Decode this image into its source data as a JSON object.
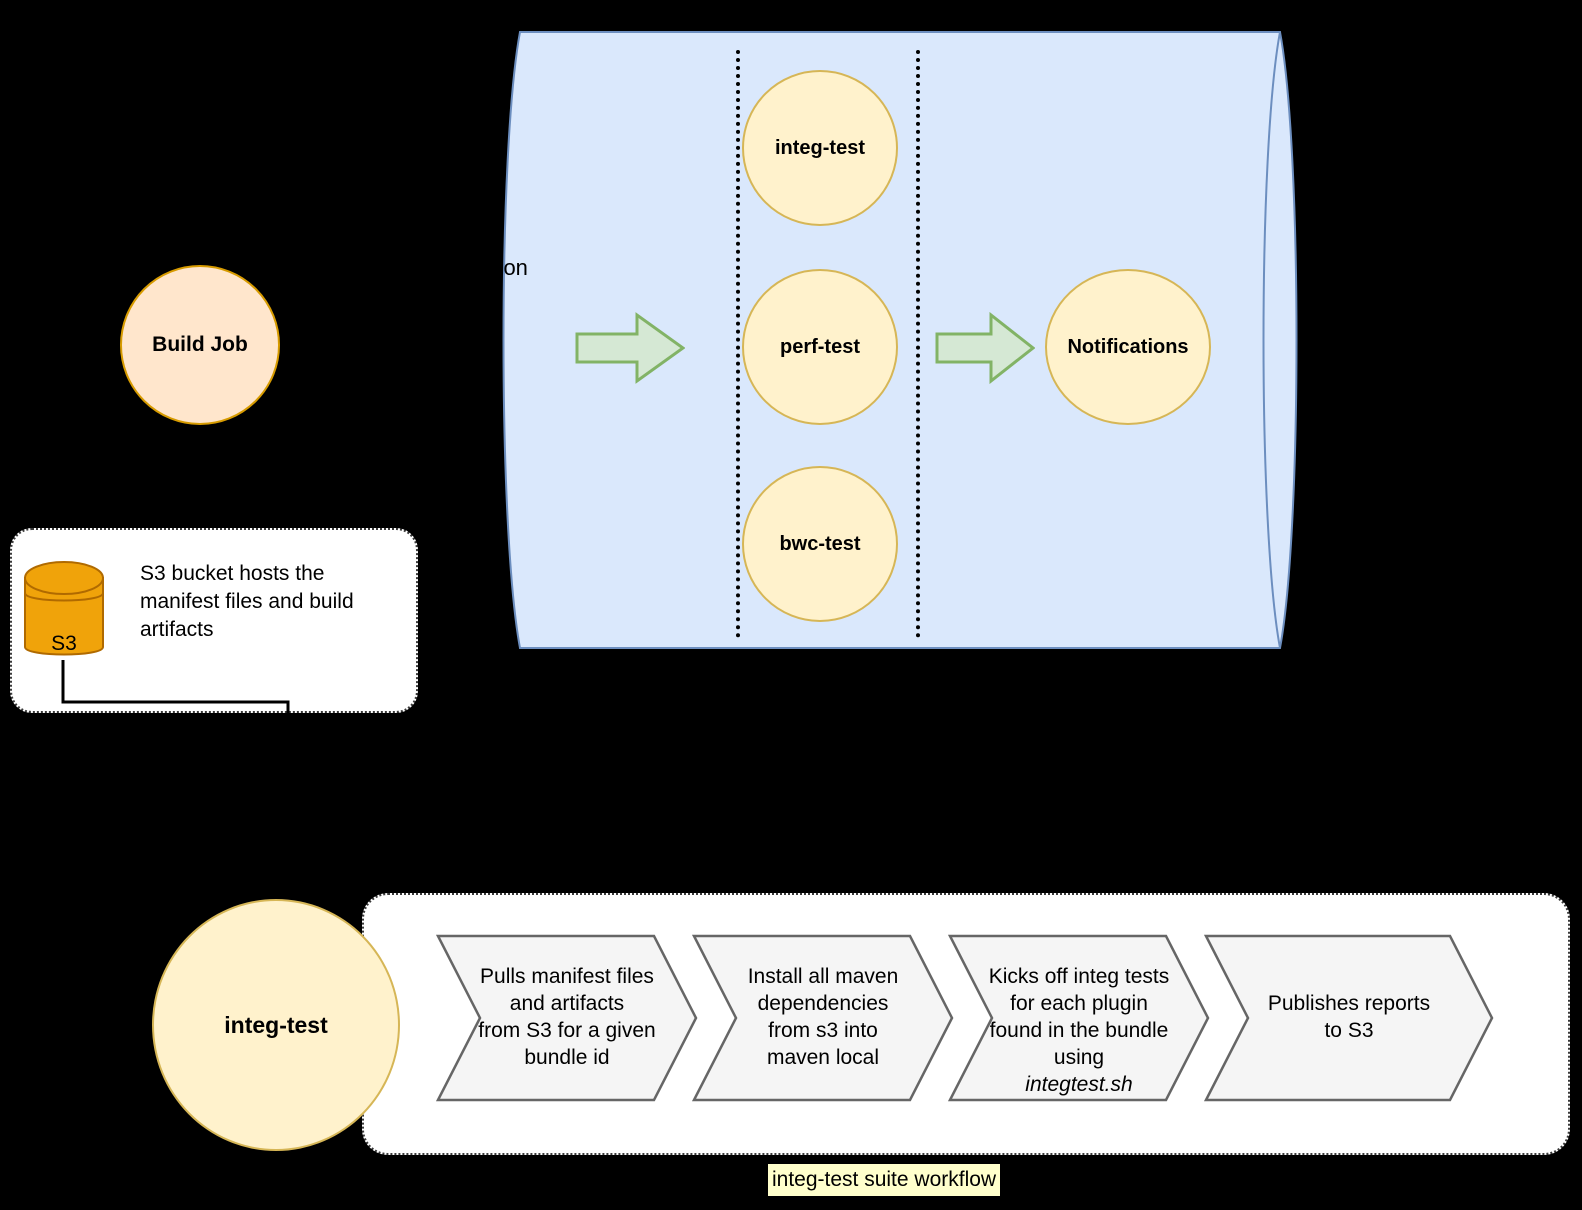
{
  "diagram": {
    "title": "integ-test suite workflow",
    "caption_highlight_color": "#FFFFCC"
  },
  "build": {
    "job_label": "Build Job"
  },
  "storage": {
    "cylinder_label": "S3",
    "description": "S3 bucket hosts the manifest files and build artifacts",
    "fill_color": "#F0A30A",
    "stroke_color": "#B06A00"
  },
  "test_suite": {
    "clipped_label": "ersion",
    "cylinder_fill": "#DAE8FC",
    "cylinder_stroke": "#6C8EBF",
    "lanes": [
      {
        "label": "integ-test"
      },
      {
        "label": "perf-test"
      },
      {
        "label": "bwc-test"
      }
    ],
    "notifications_label": "Notifications",
    "arrow_fill": "#D5E8D4",
    "arrow_stroke": "#82B366",
    "circle_fill": "#FFF2CC",
    "circle_stroke": "#D6B656"
  },
  "integ_workflow": {
    "actor_label": "integ-test",
    "steps": [
      {
        "text": "Pulls manifest files\nand artifacts\nfrom S3 for a given\nbundle id",
        "italic_tail": ""
      },
      {
        "text": "Install all maven\ndependencies\nfrom s3 into\nmaven local",
        "italic_tail": ""
      },
      {
        "text": "Kicks off integ tests\nfor each plugin\nfound in the bundle\nusing\n",
        "italic_tail": "integtest.sh"
      },
      {
        "text": "Publishes reports\nto S3",
        "italic_tail": ""
      }
    ],
    "step_fill": "#F5F5F5",
    "step_stroke": "#666666"
  }
}
